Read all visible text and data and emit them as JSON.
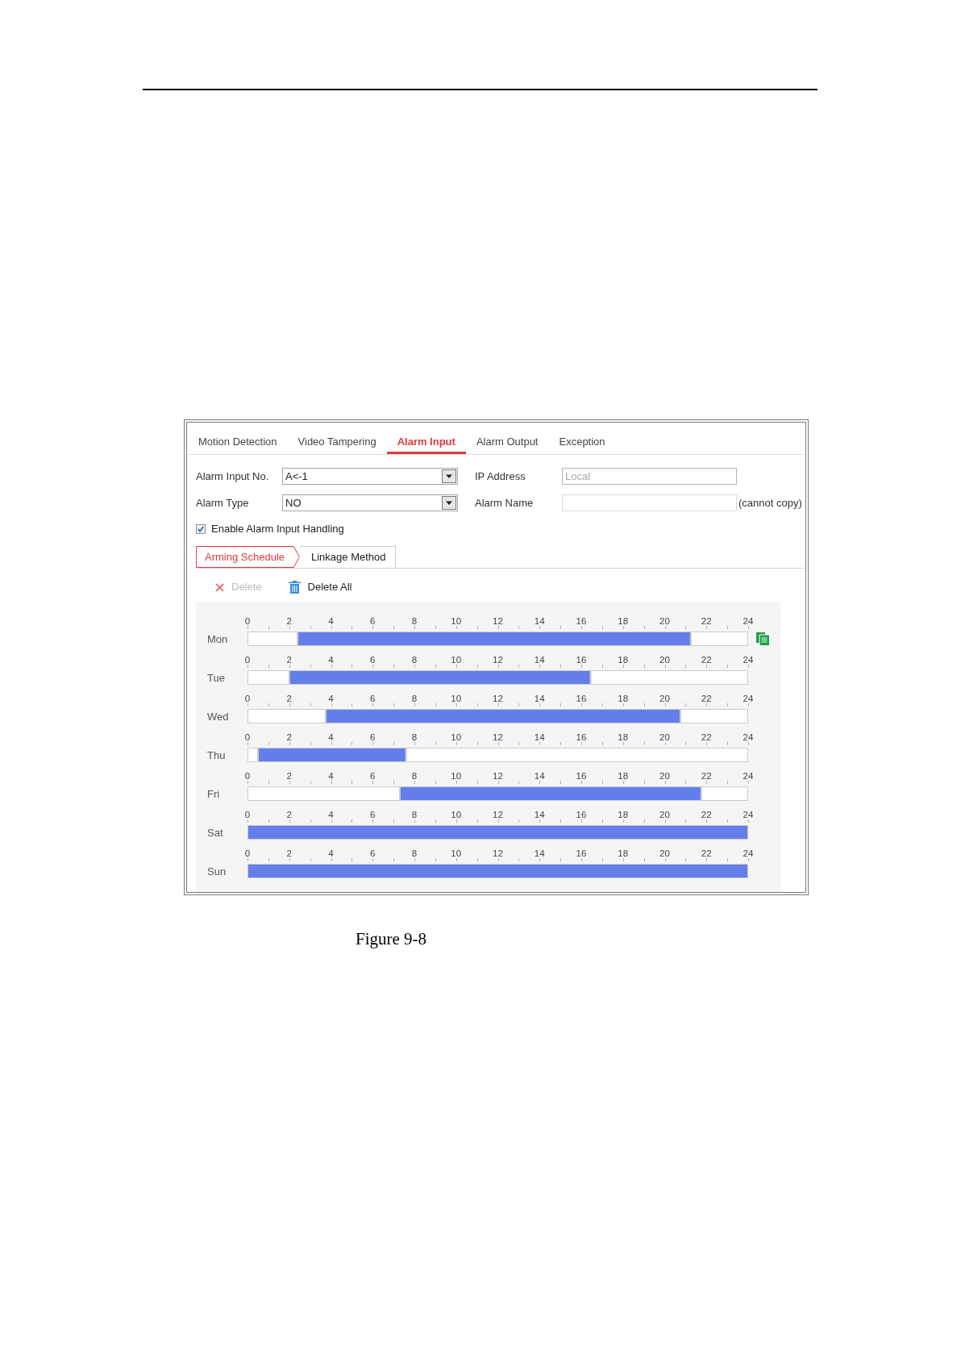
{
  "figure": {
    "tabs": [
      {
        "label": "Motion Detection",
        "selected": false
      },
      {
        "label": "Video Tampering",
        "selected": false
      },
      {
        "label": "Alarm Input",
        "selected": true
      },
      {
        "label": "Alarm Output",
        "selected": false
      },
      {
        "label": "Exception",
        "selected": false
      }
    ],
    "form_rows": [
      {
        "fields": [
          {
            "kind": "select",
            "label": "Alarm Input No.",
            "value": "A<-1",
            "disabled": false
          },
          {
            "kind": "text",
            "label": "IP Address",
            "value": "Local",
            "disabled": true
          }
        ]
      },
      {
        "fields": [
          {
            "kind": "select",
            "label": "Alarm Type",
            "value": "NO",
            "disabled": false
          },
          {
            "kind": "text",
            "label": "Alarm Name",
            "disabled": false,
            "note": "(cannot copy)"
          }
        ]
      }
    ],
    "checkbox": {
      "label": "Enable Alarm Input Handling",
      "checked": true
    },
    "subtabs": [
      {
        "label": "Arming Schedule",
        "selected": true
      },
      {
        "label": "Linkage Method",
        "selected": false
      }
    ],
    "actions": [
      {
        "kind": "delete",
        "label": "Delete",
        "disabled": true
      },
      {
        "kind": "delete_all",
        "label": "Delete All",
        "disabled": false
      }
    ],
    "schedule": [
      {
        "copy": true,
        "chart_data": {
          "type": "bar",
          "orientation": "horizontal",
          "stacked": true,
          "categories": [
            "Mon"
          ],
          "series": [
            {
              "color": "#ffffff",
              "values": [
                2.4
              ]
            },
            {
              "color": "#647eec",
              "values": [
                18.85
              ]
            },
            {
              "color": "#ffffff",
              "values": [
                2.75
              ]
            }
          ],
          "xlim": [
            0,
            24
          ],
          "xticks": [
            0,
            2,
            4,
            6,
            8,
            10,
            12,
            14,
            16,
            18,
            20,
            22,
            24
          ]
        }
      },
      {
        "copy": false,
        "chart_data": {
          "type": "bar",
          "orientation": "horizontal",
          "stacked": true,
          "categories": [
            "Tue"
          ],
          "series": [
            {
              "color": "#ffffff",
              "values": [
                2
              ]
            },
            {
              "color": "#647eec",
              "values": [
                14.45
              ]
            },
            {
              "color": "#ffffff",
              "values": [
                7.55
              ]
            }
          ],
          "xlim": [
            0,
            24
          ],
          "xticks": [
            0,
            2,
            4,
            6,
            8,
            10,
            12,
            14,
            16,
            18,
            20,
            22,
            24
          ]
        }
      },
      {
        "copy": false,
        "chart_data": {
          "type": "bar",
          "orientation": "horizontal",
          "stacked": true,
          "categories": [
            "Wed"
          ],
          "series": [
            {
              "color": "#ffffff",
              "values": [
                3.75
              ]
            },
            {
              "color": "#647eec",
              "values": [
                17
              ]
            },
            {
              "color": "#ffffff",
              "values": [
                3.25
              ]
            }
          ],
          "xlim": [
            0,
            24
          ],
          "xticks": [
            0,
            2,
            4,
            6,
            8,
            10,
            12,
            14,
            16,
            18,
            20,
            22,
            24
          ]
        }
      },
      {
        "copy": false,
        "chart_data": {
          "type": "bar",
          "orientation": "horizontal",
          "stacked": true,
          "categories": [
            "Thu"
          ],
          "series": [
            {
              "color": "#ffffff",
              "values": [
                0.5
              ]
            },
            {
              "color": "#647eec",
              "values": [
                7.1
              ]
            },
            {
              "color": "#ffffff",
              "values": [
                16.4
              ]
            }
          ],
          "xlim": [
            0,
            24
          ],
          "xticks": [
            0,
            2,
            4,
            6,
            8,
            10,
            12,
            14,
            16,
            18,
            20,
            22,
            24
          ]
        }
      },
      {
        "copy": false,
        "chart_data": {
          "type": "bar",
          "orientation": "horizontal",
          "stacked": true,
          "categories": [
            "Fri"
          ],
          "series": [
            {
              "color": "#ffffff",
              "values": [
                7.3
              ]
            },
            {
              "color": "#647eec",
              "values": [
                14.45
              ]
            },
            {
              "color": "#ffffff",
              "values": [
                2.25
              ]
            }
          ],
          "xlim": [
            0,
            24
          ],
          "xticks": [
            0,
            2,
            4,
            6,
            8,
            10,
            12,
            14,
            16,
            18,
            20,
            22,
            24
          ]
        }
      },
      {
        "copy": false,
        "chart_data": {
          "type": "bar",
          "orientation": "horizontal",
          "stacked": true,
          "categories": [
            "Sat"
          ],
          "series": [
            {
              "color": "#647eec",
              "values": [
                24
              ]
            }
          ],
          "xlim": [
            0,
            24
          ],
          "xticks": [
            0,
            2,
            4,
            6,
            8,
            10,
            12,
            14,
            16,
            18,
            20,
            22,
            24
          ]
        }
      },
      {
        "copy": false,
        "chart_data": {
          "type": "bar",
          "orientation": "horizontal",
          "stacked": true,
          "categories": [
            "Sun"
          ],
          "series": [
            {
              "color": "#647eec",
              "values": [
                24
              ]
            }
          ],
          "xlim": [
            0,
            24
          ],
          "xticks": [
            0,
            2,
            4,
            6,
            8,
            10,
            12,
            14,
            16,
            18,
            20,
            22,
            24
          ]
        }
      }
    ]
  },
  "caption": "Figure 9-8"
}
